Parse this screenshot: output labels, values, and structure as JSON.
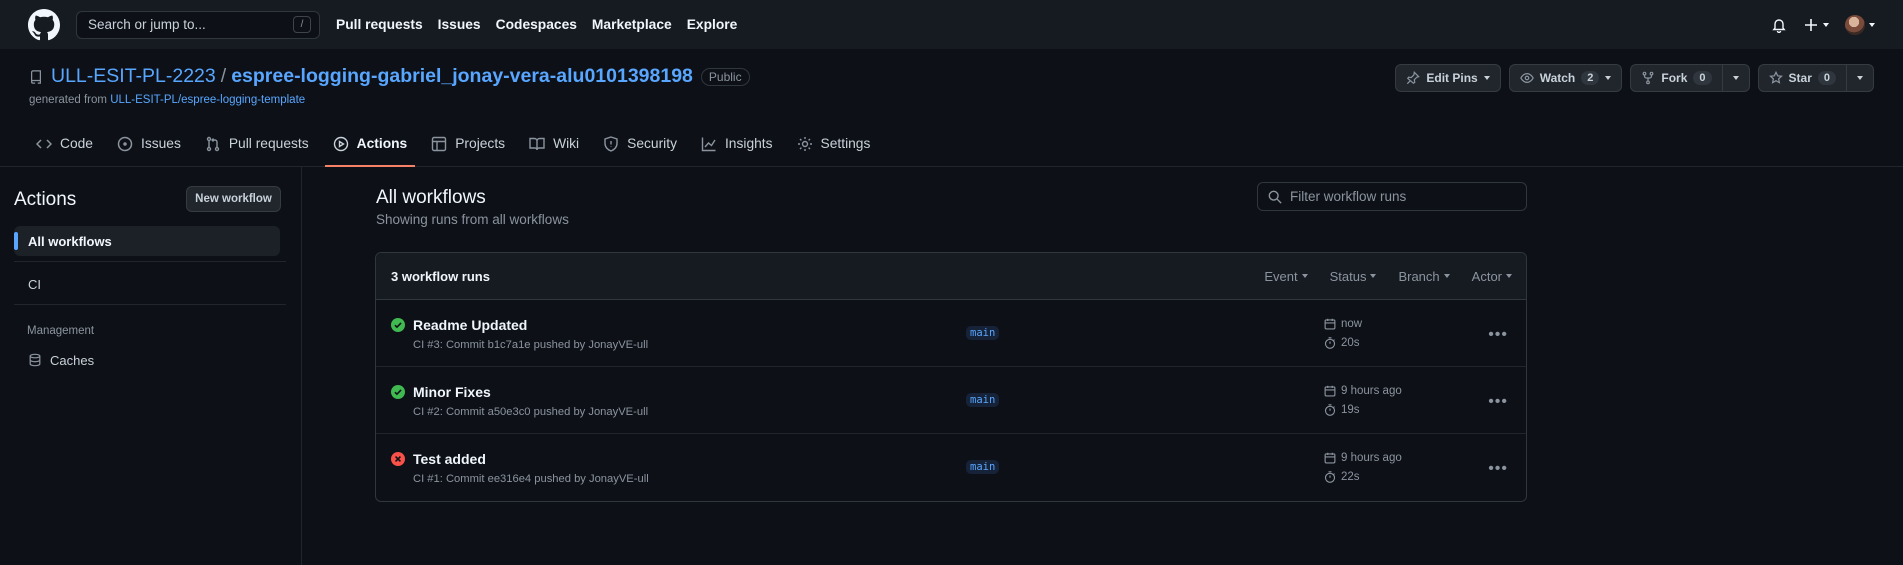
{
  "topbar": {
    "search_placeholder": "Search or jump to...",
    "search_key": "/",
    "nav": [
      "Pull requests",
      "Issues",
      "Codespaces",
      "Marketplace",
      "Explore"
    ]
  },
  "repo": {
    "owner": "ULL-ESIT-PL-2223",
    "separator": "/",
    "name": "espree-logging-gabriel_jonay-vera-alu0101398198",
    "visibility": "Public",
    "generated_prefix": "generated from",
    "template": "ULL-ESIT-PL/espree-logging-template",
    "buttons": {
      "edit_pins": "Edit Pins",
      "watch": "Watch",
      "watch_count": "2",
      "fork": "Fork",
      "fork_count": "0",
      "star": "Star",
      "star_count": "0"
    },
    "tabs": [
      "Code",
      "Issues",
      "Pull requests",
      "Actions",
      "Projects",
      "Wiki",
      "Security",
      "Insights",
      "Settings"
    ]
  },
  "sidebar": {
    "title": "Actions",
    "new_workflow": "New workflow",
    "all_workflows": "All workflows",
    "ci": "CI",
    "management_label": "Management",
    "caches": "Caches"
  },
  "main": {
    "title": "All workflows",
    "subtitle": "Showing runs from all workflows",
    "filter_placeholder": "Filter workflow runs",
    "runs_count": "3 workflow runs",
    "filters": [
      "Event",
      "Status",
      "Branch",
      "Actor"
    ],
    "runs": [
      {
        "title": "Readme Updated",
        "meta": "CI #3: Commit b1c7a1e pushed by JonayVE-ull",
        "branch": "main",
        "time": "now",
        "duration": "20s",
        "status": "success"
      },
      {
        "title": "Minor Fixes",
        "meta": "CI #2: Commit a50e3c0 pushed by JonayVE-ull",
        "branch": "main",
        "time": "9 hours ago",
        "duration": "19s",
        "status": "success"
      },
      {
        "title": "Test added",
        "meta": "CI #1: Commit ee316e4 pushed by JonayVE-ull",
        "branch": "main",
        "time": "9 hours ago",
        "duration": "22s",
        "status": "failure"
      }
    ]
  },
  "colors": {
    "success": "#3fb950",
    "failure": "#f85149",
    "accent": "#58a6ff",
    "tab_underline": "#f78166"
  }
}
